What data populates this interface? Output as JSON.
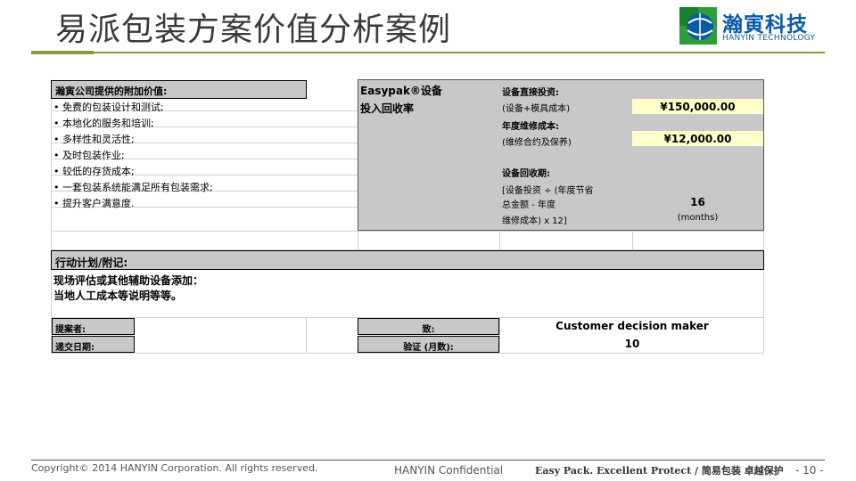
{
  "slide": {
    "title": "易派包装方案价值分析案例",
    "logo": {
      "name_cn": "瀚寅科技",
      "name_en": "HANYIN TECHNOLOGY"
    }
  },
  "value_added": {
    "header": "瀚寅公司提供的附加价值:",
    "items": [
      "• 免费的包装设计和测试;",
      "• 本地化的服务和培训;",
      "•  多样性和灵活性;",
      "•  及时包装作业;",
      "•  较低的存货成本;",
      "•  一套包装系统能满足所有包装需求;",
      "•  提升客户满意度."
    ]
  },
  "roi": {
    "equipment_label": "Easypak®设备",
    "roi_label": "投入回收率",
    "direct_investment_label": "设备直接投资:",
    "direct_investment_sub": "(设备+模具成本)",
    "direct_investment_value": "¥150,000.00",
    "maintenance_label": "年度维修成本:",
    "maintenance_sub": "(维修合约及保养)",
    "maintenance_value": "¥12,000.00",
    "payback_label": "设备回收期:",
    "payback_formula": [
      "[设备投资 ÷ (年度节省",
      "总金额 - 年度",
      "维修成本) x 12]"
    ],
    "payback_value": "16",
    "payback_unit": "(months)"
  },
  "action_plan": {
    "header": "行动计划/附记:",
    "lines": [
      "现场评估或其他辅助设备添加：",
      "当地人工成本等说明等等。"
    ]
  },
  "signoff": {
    "proposer_label": "提案者:",
    "proposer_value": "",
    "submit_date_label": "递交日期:",
    "submit_date_value": "",
    "to_label": "致:",
    "to_value": "Customer decision maker",
    "verify_label": "验证 (月数):",
    "verify_value": "10"
  },
  "footer": {
    "copyright": "Copyright© 2014 HANYIN Corporation. All rights reserved.",
    "confidential": "HANYIN Confidential",
    "slogan": "Easy Pack. Excellent Protect / 简易包装 卓越保护",
    "page": "- 10 -"
  },
  "colors": {
    "accent_green": "#8a9b3a",
    "brand_blue": "#0b5aa6",
    "header_gray": "#c8c8c8",
    "highlight_yellow": "#ffffcc"
  },
  "icons": {
    "logo_mark": "globe-logo-icon"
  }
}
